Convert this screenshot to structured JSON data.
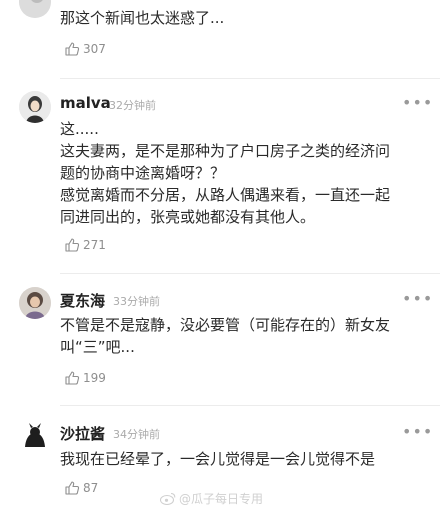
{
  "comments": [
    {
      "lines": [
        "那这个新闻也太迷惑了..."
      ],
      "likes": "307"
    },
    {
      "name": "malva",
      "time": "32分钟前",
      "lines": [
        "这.....",
        "这夫妻两，是不是那种为了户口房子之类的经济问",
        "题的协商中途离婚呀？？",
        "感觉离婚而不分居，从路人偶遇来看，一直还一起",
        "同进同出的，张亮或她都没有其他人。"
      ],
      "likes": "271"
    },
    {
      "name": "夏东海",
      "time": "33分钟前",
      "lines": [
        "不管是不是寇静，没必要管（可能存在的）新女友",
        "叫“三”吧..."
      ],
      "likes": "199"
    },
    {
      "name": "沙拉酱",
      "time": "34分钟前",
      "lines": [
        "我现在已经晕了，一会儿觉得是一会儿觉得不是"
      ],
      "likes": "87"
    }
  ],
  "watermark": "@瓜子每日专用",
  "icons": {
    "like": "thumbs-up-icon",
    "more": "more-dots-icon",
    "watermark": "weibo-logo-icon"
  },
  "colors": {
    "text": "#2a2a2a",
    "meta": "#aaaaaa",
    "divider": "#ececec"
  }
}
